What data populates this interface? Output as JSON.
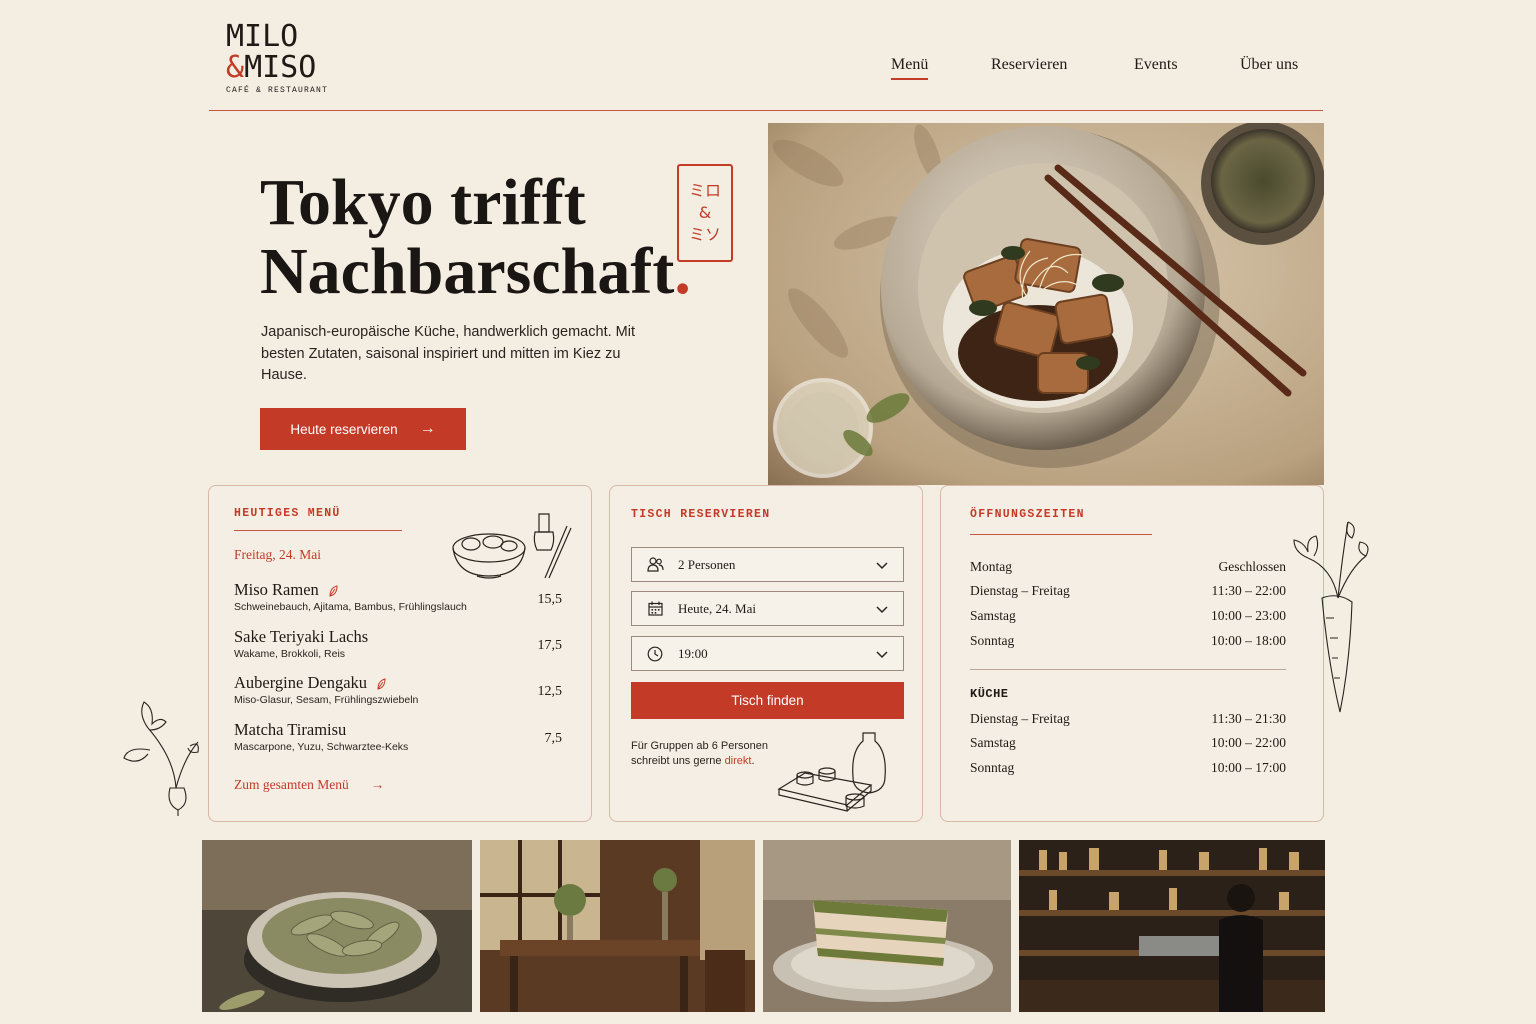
{
  "brand": {
    "line1": "MILO",
    "amp": "&",
    "line2": "MISO",
    "subtitle": "CAFÉ & RESTAURANT"
  },
  "nav": {
    "items": [
      {
        "label": "Menü",
        "active": true
      },
      {
        "label": "Reservieren",
        "active": false
      },
      {
        "label": "Events",
        "active": false
      },
      {
        "label": "Über uns",
        "active": false
      }
    ]
  },
  "hero": {
    "title_line1": "Tokyo trifft",
    "title_line2": "Nachbarschaft",
    "title_dot": ".",
    "stamp": [
      "ミロ",
      "&",
      "ミソ"
    ],
    "description": "Japanisch-europäische Küche, handwerklich gemacht. Mit besten Zutaten, saisonal inspiriert und mitten im Kiez zu Hause.",
    "cta_label": "Heute reservieren",
    "cta_icon": "arrow-right-icon"
  },
  "menu_card": {
    "title": "HEUTIGES MENÜ",
    "date": "Freitag, 24. Mai",
    "items": [
      {
        "name": "Miso Ramen",
        "description": "Schweinebauch, Ajitama, Bambus, Frühlingslauch",
        "price": "15,5",
        "vegetarian": false,
        "leaf": true
      },
      {
        "name": "Sake Teriyaki Lachs",
        "description": "Wakame, Brokkoli, Reis",
        "price": "17,5",
        "leaf": false
      },
      {
        "name": "Aubergine Dengaku",
        "description": "Miso-Glasur, Sesam, Frühlingszwiebeln",
        "price": "12,5",
        "leaf": true
      },
      {
        "name": "Matcha Tiramisu",
        "description": "Mascarpone, Yuzu, Schwarztee-Keks",
        "price": "7,5",
        "leaf": false
      }
    ],
    "link_label": "Zum gesamten Menü"
  },
  "reservation_card": {
    "title": "TISCH RESERVIEREN",
    "guests": {
      "value": "2 Personen",
      "icon": "people-icon"
    },
    "date": {
      "value": "Heute, 24. Mai",
      "icon": "calendar-icon"
    },
    "time": {
      "value": "19:00",
      "icon": "clock-icon"
    },
    "submit_label": "Tisch finden",
    "note_text": "Für Gruppen ab 6 Personen schreibt uns gerne ",
    "note_link": "direkt",
    "note_end": "."
  },
  "hours_card": {
    "title": "ÖFFNUNGSZEITEN",
    "opening": [
      {
        "day": "Montag",
        "time": "Geschlossen"
      },
      {
        "day": "Dienstag – Freitag",
        "time": "11:30 – 22:00"
      },
      {
        "day": "Samstag",
        "time": "10:00 – 23:00"
      },
      {
        "day": "Sonntag",
        "time": "10:00 – 18:00"
      }
    ],
    "kitchen_title": "KÜCHE",
    "kitchen": [
      {
        "day": "Dienstag – Freitag",
        "time": "11:30 – 21:30"
      },
      {
        "day": "Samstag",
        "time": "10:00 – 22:00"
      },
      {
        "day": "Sonntag",
        "time": "10:00 – 17:00"
      }
    ]
  },
  "colors": {
    "accent": "#c33b27",
    "background": "#f3ede2",
    "text": "#1f1a16"
  }
}
